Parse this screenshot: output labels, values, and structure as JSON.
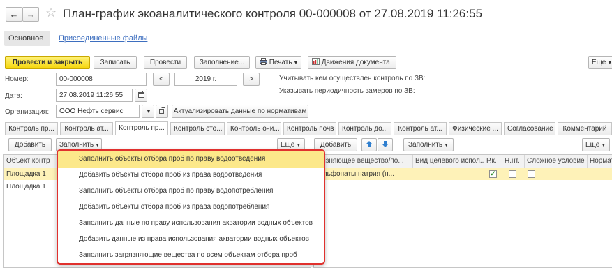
{
  "window": {
    "title": "План-график экоаналитического контроля 00-000008 от 27.08.2019 11:26:55",
    "back_glyph": "←",
    "forward_glyph": "→",
    "star_glyph": "☆"
  },
  "nav_tabs": {
    "main": "Основное",
    "files": "Присоединенные файлы"
  },
  "toolbar": {
    "post_close": "Провести и закрыть",
    "save": "Записать",
    "post": "Провести",
    "fill": "Заполнение...",
    "print": "Печать",
    "movements": "Движения документа",
    "more": "Еще"
  },
  "form": {
    "number_label": "Номер:",
    "number_value": "00-000008",
    "year_prev": "<",
    "year_value": "2019 г.",
    "year_next": ">",
    "date_label": "Дата:",
    "date_value": "27.08.2019 11:26:55",
    "org_label": "Организация:",
    "org_value": "ООО Нефть сервис",
    "update_btn": "Актуализировать данные по нормативам",
    "check1_label": "Учитывать кем осуществлен контроль по ЗВ:",
    "check2_label": "Указывать периодичность замеров по ЗВ:"
  },
  "tabs": [
    "Контроль пр...",
    "Контроль ат...",
    "Контроль пр...",
    "Контроль сто...",
    "Контроль очи...",
    "Контроль почв",
    "Контроль до...",
    "Контроль ат...",
    "Физические ...",
    "Согласование",
    "Комментарий"
  ],
  "left_panel": {
    "add": "Добавить",
    "fill": "Заполнить",
    "more": "Еще",
    "col_object": "Объект контр",
    "rows": [
      "Площадка 1",
      "Площадка 1"
    ]
  },
  "right_panel": {
    "add": "Добавить",
    "fill": "Заполнить",
    "more": "Еще",
    "columns": [
      "...язняющее вещество/по...",
      "Вид целевого испол...",
      "Р.к.",
      "Н.нт.",
      "Сложное условие",
      "Нормат"
    ],
    "row_substance": "сульфонаты натрия (н...",
    "row_rk_checked": true,
    "check_glyph": "✓"
  },
  "dropdown": {
    "items": [
      "Заполнить объекты отбора проб по праву водоотведения",
      "Добавить объекты отбора проб из права водоотведения",
      "Заполнить объекты отбора проб по праву водопотребления",
      "Добавить объекты отбора проб из права водопотребления",
      "Заполнить данные по праву использования акватории водных объектов",
      "Добавить данные из права использования акватории водных объектов",
      "Заполнить загрязняющие вещества по всем объектам отбора проб"
    ],
    "highlighted_index": 0,
    "outline_color": "#e0312e"
  },
  "colors": {
    "accent_yellow": "#f5d60a",
    "row_highlight": "#fef2b8",
    "link": "#3d6ebf"
  }
}
